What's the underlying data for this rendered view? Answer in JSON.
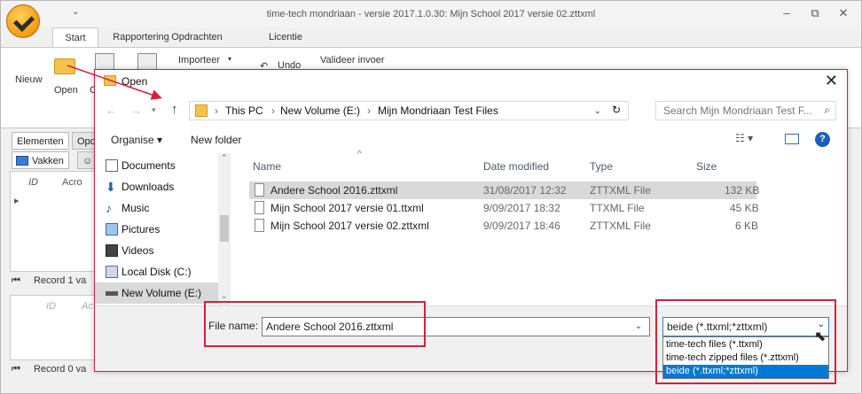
{
  "app": {
    "title": "time-tech mondriaan - versie 2017.1.0.30: Mijn School 2017 versie 02.zttxml",
    "qat_label": "⌄",
    "tabs": [
      "Start",
      "Rapportering",
      "Opdrachten",
      "Licentie"
    ],
    "ribbon": {
      "nieuw": "Nieuw",
      "open": "Open",
      "partial": "C",
      "importeer": "Importeer",
      "undo": "Undo",
      "valideer": "Valideer invoer"
    },
    "leftpane": {
      "tabs": [
        "Elementen",
        "Opd"
      ],
      "vakken": "Vakken",
      "grid1_headers": [
        "ID",
        "Acro"
      ],
      "record1": "Record 1 va",
      "grid2_headers": [
        "ID",
        "Ac"
      ],
      "record2": "Record 0 va"
    }
  },
  "dialog": {
    "title": "Open",
    "breadcrumb": [
      "This PC",
      "New Volume (E:)",
      "Mijn Mondriaan Test Files"
    ],
    "search_placeholder": "Search Mijn Mondriaan Test F...",
    "toolbar": {
      "organise": "Organise",
      "new_folder": "New folder"
    },
    "nav_items": [
      "Documents",
      "Downloads",
      "Music",
      "Pictures",
      "Videos",
      "Local Disk (C:)",
      "New Volume (E:)"
    ],
    "columns": [
      "Name",
      "Date modified",
      "Type",
      "Size"
    ],
    "files": [
      {
        "name": "Andere School 2016.zttxml",
        "date": "31/08/2017 12:32",
        "type": "ZTTXML File",
        "size": "132 KB"
      },
      {
        "name": "Mijn School 2017 versie 01.ttxml",
        "date": "9/09/2017 18:32",
        "type": "TTXML File",
        "size": "45 KB"
      },
      {
        "name": "Mijn School 2017 versie 02.zttxml",
        "date": "9/09/2017 18:46",
        "type": "ZTTXML File",
        "size": "6 KB"
      }
    ],
    "filename_label": "File name:",
    "filename_value": "Andere School 2016.zttxml",
    "filetype_selected": "beide (*.ttxml;*zttxml)",
    "filetype_options": [
      "time-tech files (*.ttxml)",
      "time-tech zipped files (*.zttxml)",
      "beide (*.ttxml;*zttxml)"
    ]
  },
  "colors": {
    "highlight": "#d6203a",
    "select_blue": "#0078d7"
  }
}
